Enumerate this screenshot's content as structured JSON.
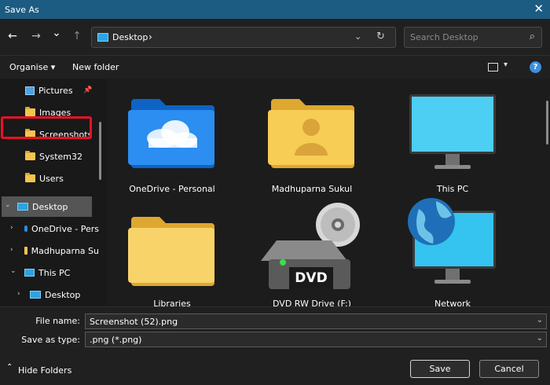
{
  "window": {
    "title": "Save As",
    "close_glyph": "✕"
  },
  "nav": {
    "back_glyph": "←",
    "forward_glyph": "→",
    "recent_glyph": "⌄",
    "up_glyph": "↑",
    "address": {
      "location": "Desktop",
      "separator": "›",
      "dropdown_glyph": "⌄",
      "refresh_glyph": "↻"
    },
    "search": {
      "placeholder": "Search Desktop",
      "icon_glyph": "⌕"
    }
  },
  "toolbar": {
    "organise_label": "Organise ▾",
    "new_folder_label": "New folder",
    "view_dropdown_glyph": "▾",
    "help_glyph": "?"
  },
  "sidebar": {
    "items": [
      {
        "label": "Pictures",
        "icon": "pictures-icon",
        "pinned": true
      },
      {
        "label": "Images",
        "icon": "folder-icon"
      },
      {
        "label": "Screenshots",
        "icon": "folder-icon"
      },
      {
        "label": "System32",
        "icon": "folder-icon"
      },
      {
        "label": "Users",
        "icon": "folder-icon"
      },
      {
        "label": "Desktop",
        "icon": "desktop-icon",
        "selected": true,
        "expanded": true
      },
      {
        "label": "OneDrive - Pers",
        "icon": "cloud-icon"
      },
      {
        "label": "Madhuparna Su",
        "icon": "user-folder-icon"
      },
      {
        "label": "This PC",
        "icon": "pc-icon",
        "expanded": true
      },
      {
        "label": "Desktop",
        "icon": "desktop-icon"
      }
    ],
    "pin_glyph": "📌",
    "chevron_right": "›",
    "chevron_down": "⌄"
  },
  "content": {
    "items": [
      {
        "label": "OneDrive - Personal",
        "icon": "onedrive-folder-icon"
      },
      {
        "label": "Madhuparna Sukul",
        "icon": "user-folder-icon"
      },
      {
        "label": "This PC",
        "icon": "monitor-icon"
      },
      {
        "label": "Libraries",
        "icon": "folder-icon"
      },
      {
        "label": "DVD RW Drive (F:)",
        "icon": "dvd-drive-icon",
        "badge": "DVD"
      },
      {
        "label": "Network",
        "icon": "network-icon"
      }
    ]
  },
  "form": {
    "file_name_label": "File name:",
    "file_name_value": "Screenshot (52).png",
    "save_type_label": "Save as type:",
    "save_type_value": ".png (*.png)",
    "dropdown_glyph": "⌄"
  },
  "footer": {
    "hide_folders_label": "Hide Folders",
    "hide_glyph": "⌃",
    "save_label": "Save",
    "cancel_label": "Cancel"
  },
  "colors": {
    "titlebar": "#1c5c82",
    "selection_outline": "#e81224",
    "folder": "#f2c54e",
    "accent": "#3a8fe0"
  }
}
